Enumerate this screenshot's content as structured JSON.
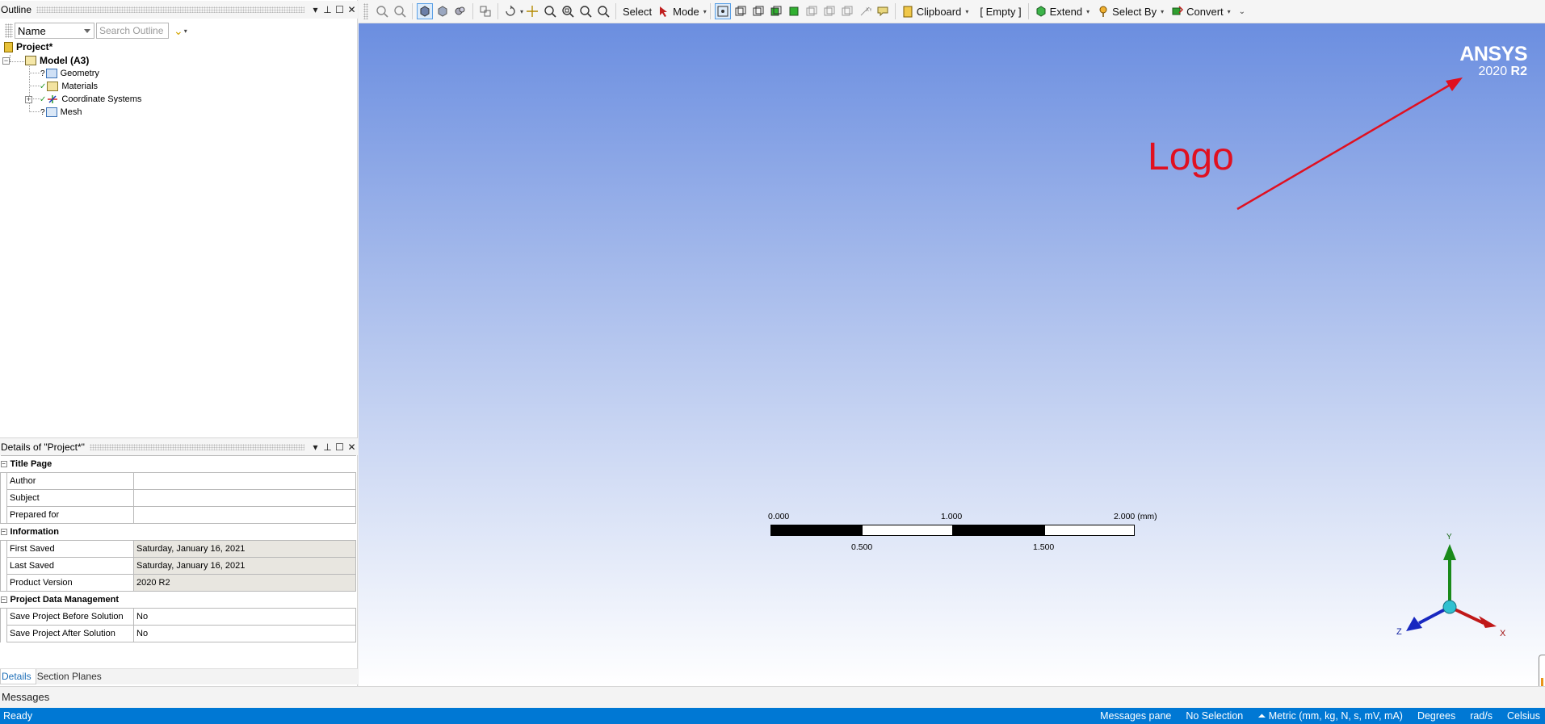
{
  "outline": {
    "title": "Outline",
    "filter_value": "Name",
    "search_placeholder": "Search Outline",
    "tree": [
      {
        "label": "Project*"
      },
      {
        "label": "Model (A3)"
      },
      {
        "label": "Geometry",
        "state": "?"
      },
      {
        "label": "Materials",
        "state": "✓"
      },
      {
        "label": "Coordinate Systems",
        "state": "✓"
      },
      {
        "label": "Mesh",
        "state": "?"
      }
    ]
  },
  "details": {
    "title": "Details of \"Project*\"",
    "sections": [
      {
        "title": "Title Page",
        "rows": [
          {
            "key": "Author",
            "value": ""
          },
          {
            "key": "Subject",
            "value": ""
          },
          {
            "key": "Prepared for",
            "value": ""
          }
        ]
      },
      {
        "title": "Information",
        "rows": [
          {
            "key": "First Saved",
            "value": "Saturday, January 16, 2021"
          },
          {
            "key": "Last Saved",
            "value": "Saturday, January 16, 2021"
          },
          {
            "key": "Product Version",
            "value": "2020 R2"
          }
        ]
      },
      {
        "title": "Project Data Management",
        "rows": [
          {
            "key": "Save Project Before Solution",
            "value": "No"
          },
          {
            "key": "Save Project After Solution",
            "value": "No"
          }
        ]
      }
    ]
  },
  "tabs": [
    "Details",
    "Section Planes"
  ],
  "messages_label": "Messages",
  "toolbar": {
    "select": "Select",
    "mode": "Mode",
    "clipboard": "Clipboard",
    "empty": "[ Empty ]",
    "extend": "Extend",
    "select_by": "Select By",
    "convert": "Convert"
  },
  "viewport": {
    "logo_brand": "ANSYS",
    "logo_version": "2020",
    "logo_release": "R2",
    "annotation": "Logo",
    "scale": {
      "labels_top": [
        "0.000",
        "1.000",
        "2.000 (mm)"
      ],
      "labels_bottom": [
        "0.500",
        "1.500"
      ]
    },
    "triad": {
      "x": "X",
      "y": "Y",
      "z": "Z"
    }
  },
  "status": {
    "ready": "Ready",
    "messages_pane": "Messages pane",
    "selection": "No Selection",
    "units": "Metric (mm, kg, N, s, mV, mA)",
    "angle": "Degrees",
    "rot": "rad/s",
    "temp": "Celsius"
  },
  "colors": {
    "accent": "#0078d4",
    "annotation_red": "#e01020",
    "viewport_top": "#6b8ee0"
  }
}
